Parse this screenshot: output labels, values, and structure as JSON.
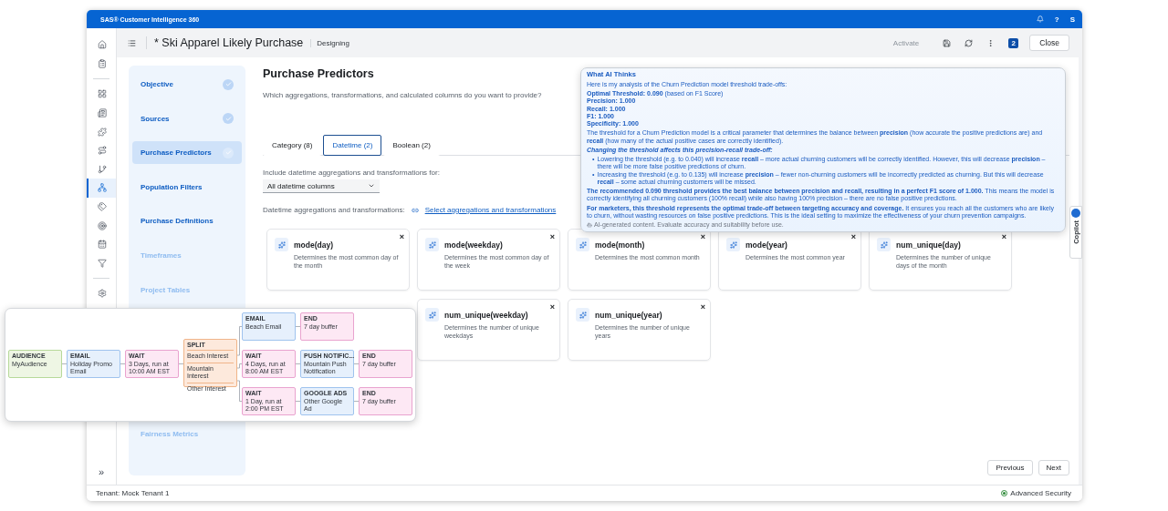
{
  "top_bar": {
    "product": "SAS® Customer Intelligence 360",
    "user_initial": "S",
    "help": "?"
  },
  "rail": [
    {
      "selected": false
    },
    {
      "selected": false
    },
    {
      "selected": false
    },
    {
      "selected": false
    },
    {
      "selected": false
    },
    {
      "selected": false
    },
    {
      "selected": false
    },
    {
      "selected": true
    },
    {
      "selected": false
    },
    {
      "selected": false
    },
    {
      "selected": false
    },
    {
      "selected": false
    },
    {
      "selected": false
    }
  ],
  "rail_expand": "»",
  "header": {
    "title": "* Ski Apparel Likely Purchase",
    "status": "Designing",
    "activate": {
      "label": "Activate",
      "disabled": true
    },
    "badge": "2",
    "close": "Close"
  },
  "steps": [
    {
      "label": "Objective",
      "completed": true,
      "selected": false,
      "disabled": false
    },
    {
      "label": "Sources",
      "completed": true,
      "selected": false,
      "disabled": false
    },
    {
      "label": "Purchase Predictors",
      "completed": true,
      "selected": true,
      "disabled": false
    },
    {
      "label": "Population Filters",
      "completed": false,
      "selected": false,
      "disabled": false
    },
    {
      "label": "Purchase Definitions",
      "completed": false,
      "selected": false,
      "disabled": false
    },
    {
      "label": "Timeframes",
      "completed": false,
      "selected": false,
      "disabled": true
    },
    {
      "label": "Project Tables",
      "completed": false,
      "selected": false,
      "disabled": true
    },
    {
      "label": "Fairness Metrics",
      "completed": false,
      "selected": false,
      "disabled": true
    }
  ],
  "page": {
    "title": "Purchase Predictors",
    "subtitle": "Which aggregations, transformations, and calculated columns do you want to provide?"
  },
  "tabs": [
    {
      "label": "Category (8)",
      "selected": false
    },
    {
      "label": "Datetime (2)",
      "selected": true
    },
    {
      "label": "Boolean (2)",
      "selected": false
    }
  ],
  "include": {
    "label": "Include datetime aggregations and transformations for:",
    "value": "All datetime columns"
  },
  "aggregations": {
    "label": "Datetime aggregations and transformations:",
    "link": "Select aggregations and transformations"
  },
  "cards": [
    {
      "title": "mode(day)",
      "description": "Determines the most common day of the month"
    },
    {
      "title": "mode(weekday)",
      "description": "Determines the most common day of the week"
    },
    {
      "title": "mode(month)",
      "description": "Determines the most common month"
    },
    {
      "title": "mode(year)",
      "description": "Determines the most common year"
    },
    {
      "title": "num_unique(day)",
      "description": "Determines the number of unique days of the month"
    },
    {
      "title": "num_unique(weekday)",
      "description": "Determines the number of unique weekdays"
    },
    {
      "title": "num_unique(year)",
      "description": "Determines the number of unique years"
    }
  ],
  "close_mark": "×",
  "buttons": {
    "previous": "Previous",
    "next": "Next"
  },
  "footer": {
    "tenant": "Tenant: Mock Tenant 1",
    "security": "Advanced Security"
  },
  "ai_panel": {
    "title": "What AI Thinks",
    "intro": "Here is my analysis of the Churn Prediction model threshold trade-offs:",
    "metrics": [
      "**Optimal Threshold: 0.090** (based on F1 Score)",
      "**Precision: 1.000**",
      "**Recall: 1.000**",
      "**F1: 1.000**",
      "**Specificity: 1.000**"
    ],
    "paragraph": "The threshold for a Churn Prediction model is a critical parameter that determines the balance between **precision** (how accurate the positive predictions are) and **recall** (how many of the actual positive cases are correctly identified).",
    "heading": "Changing the threshold affects this precision-recall trade-off:",
    "marker": "•",
    "bullets": [
      "Lowering the threshold (e.g. to 0.040) will increase **recall** – more actual churning customers will be correctly identified. However, this will decrease **precision** – there will be more false positive predictions of churn.",
      "Increasing the threshold (e.g. to 0.135) will increase **precision** – fewer non-churning customers will be incorrectly predicted as churning. But this will decrease **recall** – some actual churning customers will be missed."
    ],
    "conclusions": [
      "**The recommended 0.090 threshold provides the best balance between precision and recall, resulting in a perfect F1 score of 1.000.** This means the model is correctly identifying all churning customers (100% recall) while also having 100% precision – there are no false positive predictions.",
      "**For marketers, this threshold represents the optimal trade-off between targeting accuracy and coverage.** It ensures you reach all the customers who are likely to churn, without wasting resources on false positive predictions. This is the ideal setting to maximize the effectiveness of your churn prevention campaigns."
    ],
    "disclaimer": "AI-generated content. Evaluate accuracy and suitability before use."
  },
  "copilot": {
    "label": "Copilot"
  },
  "flow": {
    "nodes": [
      {
        "kind": "audience",
        "type": "AUDIENCE",
        "text": "MyAudience"
      },
      {
        "kind": "email",
        "type": "EMAIL",
        "text": "Holiday Promo Email"
      },
      {
        "kind": "wait",
        "type": "WAIT",
        "text": "3 Days, run at 10:00 AM EST"
      },
      {
        "kind": "split",
        "type": "SPLIT",
        "branches": [
          "Beach Interest",
          "Mountain Interest",
          "Other Interest"
        ]
      },
      {
        "kind": "email",
        "type": "EMAIL",
        "text": "Beach Email"
      },
      {
        "kind": "end",
        "type": "END",
        "text": "7 day buffer"
      },
      {
        "kind": "wait",
        "type": "WAIT",
        "text": "4 Days, run at 8:00 AM EST"
      },
      {
        "kind": "push",
        "type": "PUSH NOTIFIC...",
        "text": "Mountain Push Notification"
      },
      {
        "kind": "end",
        "type": "END",
        "text": "7 day buffer"
      },
      {
        "kind": "wait",
        "type": "WAIT",
        "text": "1 Day, run at 2:00 PM EST"
      },
      {
        "kind": "ads",
        "type": "GOOGLE ADS",
        "text": "Other Google Ad"
      },
      {
        "kind": "end",
        "type": "END",
        "text": "7 day buffer"
      }
    ]
  }
}
